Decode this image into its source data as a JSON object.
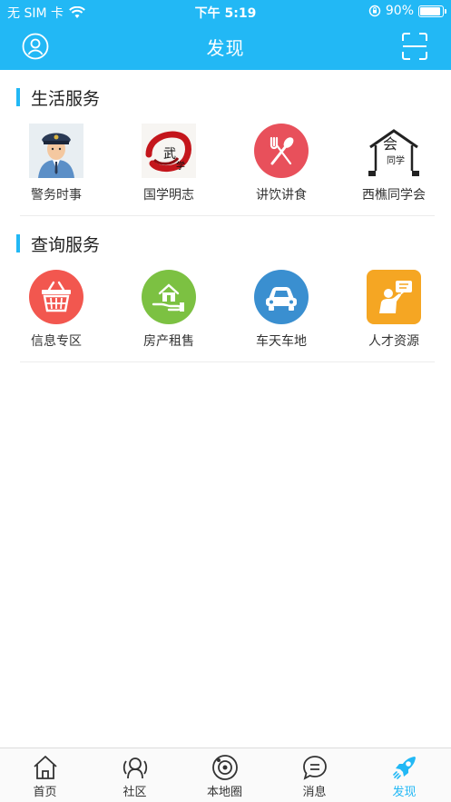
{
  "status_bar": {
    "carrier": "无 SIM 卡",
    "time": "下午 5:19",
    "battery": "90%",
    "battery_level": 0.9
  },
  "nav": {
    "title": "发现",
    "left_icon": "user-circle-icon",
    "right_icon": "scan-icon"
  },
  "sections": [
    {
      "title": "生活服务",
      "items": [
        {
          "label": "警务时事",
          "icon": "police-officer-icon"
        },
        {
          "label": "国学明志",
          "icon": "calligraphy-icon"
        },
        {
          "label": "讲饮讲食",
          "icon": "fork-spoon-icon"
        },
        {
          "label": "西樵同学会",
          "icon": "alumni-logo-icon"
        }
      ]
    },
    {
      "title": "查询服务",
      "items": [
        {
          "label": "信息专区",
          "icon": "basket-icon"
        },
        {
          "label": "房产租售",
          "icon": "house-hand-icon"
        },
        {
          "label": "车天车地",
          "icon": "car-icon"
        },
        {
          "label": "人才资源",
          "icon": "person-presenting-icon"
        }
      ]
    }
  ],
  "tabbar": {
    "tabs": [
      {
        "label": "首页",
        "icon": "home-icon"
      },
      {
        "label": "社区",
        "icon": "community-icon"
      },
      {
        "label": "本地圈",
        "icon": "local-circle-icon"
      },
      {
        "label": "消息",
        "icon": "message-icon"
      },
      {
        "label": "发现",
        "icon": "discover-rocket-icon",
        "active": true
      }
    ]
  },
  "colors": {
    "accent": "#22b8f5",
    "food_red": "#e8505b",
    "basket_red": "#f2574f",
    "house_green": "#7cc142",
    "car_blue": "#3a8fd0",
    "talent_orange": "#f5a623"
  }
}
